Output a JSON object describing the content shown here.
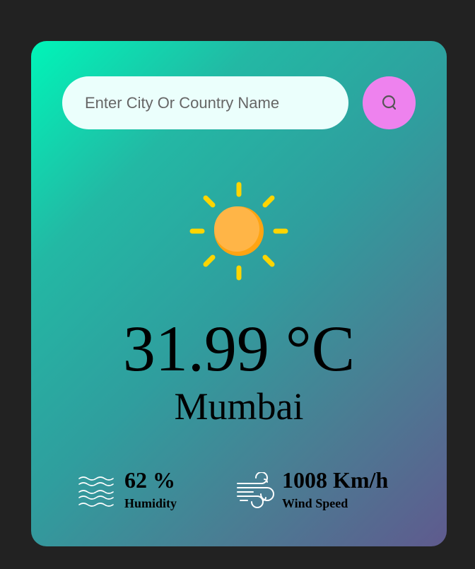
{
  "search": {
    "placeholder": "Enter City Or Country Name",
    "value": "",
    "button_icon": "search-icon"
  },
  "weather": {
    "icon": "sun-icon",
    "temperature": "31.99 °C",
    "city": "Mumbai"
  },
  "details": {
    "humidity": {
      "icon": "humidity-waves-icon",
      "value": "62 %",
      "label": "Humidity"
    },
    "wind": {
      "icon": "wind-icon",
      "value": "1008 Km/h",
      "label": "Wind Speed"
    }
  },
  "colors": {
    "page_background": "#222222",
    "card_gradient_start": "#00f5b8",
    "card_gradient_end": "#5f5a8e",
    "search_button": "#ee82ee",
    "sun_core": "#ffae35",
    "sun_rays": "#ffd500"
  }
}
